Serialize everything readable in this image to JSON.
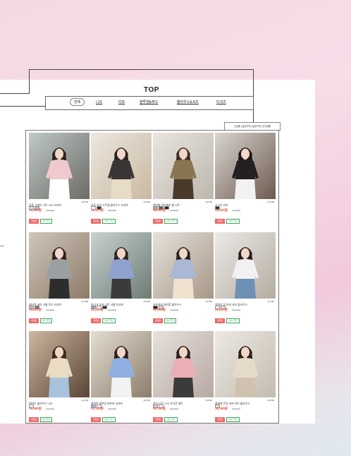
{
  "page": {
    "title": "TOP"
  },
  "categories": [
    {
      "label": "전체",
      "active": true
    },
    {
      "label": "니트",
      "active": false
    },
    {
      "label": "티트",
      "active": false
    },
    {
      "label": "맨투맨&후드",
      "active": false
    },
    {
      "label": "블라우스&셔츠",
      "active": false
    },
    {
      "label": "티셔츠",
      "active": false
    }
  ],
  "sort": {
    "label": "신상품 | 낮은가격 | 높은가격 | 인기상품"
  },
  "colors": {
    "price": "#e04a3a",
    "sale_badge": "#ef6a6a",
    "event_badge": "#3aa55a",
    "grid_border": "#777777"
  },
  "products": [
    {
      "name": "심플 그레이 나트 나시 티셔츠",
      "price": "19,660원",
      "old": "21,600원",
      "badge1": "세일중",
      "badge2": "9% 할인",
      "opts": "[44-66]",
      "swatches": [
        "#cfe3f7",
        "#a7c6e6"
      ],
      "bg": [
        "#bfc9c5",
        "#6c6a66"
      ],
      "hair": "#2a2220",
      "top": "#f0c9cf",
      "bottom": "#ffffff"
    },
    {
      "name": "오픈 사선 스트랩 블라우스 티셔츠",
      "price": "14,220원",
      "old": "15,800원",
      "badge1": "세일중",
      "badge2": "10% 할인",
      "opts": "[44-66]",
      "swatches": [
        "#ffffff",
        "#333333"
      ],
      "bg": [
        "#ece7de",
        "#c9b8a2"
      ],
      "hair": "#2b2220",
      "top": "#3a3535",
      "bottom": "#e7dcc6"
    },
    {
      "name": "케이블 라인베어 쓸 니트",
      "price": "36,955원",
      "old": "41,060원",
      "badge1": "세일중",
      "badge2": "10% 할인",
      "opts": "[44-66]",
      "swatches": [
        "#b7a58a",
        "#6d5a44",
        "#222222"
      ],
      "bg": [
        "#e9e5df",
        "#bdb7ad"
      ],
      "hair": "#3a2d25",
      "top": "#8a7552",
      "bottom": "#4a3a2a"
    },
    {
      "name": "시스루 셔츠",
      "price": "16,020원",
      "old": "17,800원",
      "badge1": "세일중",
      "badge2": "10% 할인",
      "opts": "[44-66]",
      "swatches": [
        "#333333"
      ],
      "bg": [
        "#d9d4cf",
        "#6d5a4f"
      ],
      "hair": "#201818",
      "top": "#231f22",
      "bottom": "#f2f2f2"
    },
    {
      "name": "레터링 세라 크롭 후드 티셔츠",
      "price": "29,620원",
      "old": "32,800원",
      "badge1": "세일중",
      "badge2": "9% 할인",
      "opts": "[44-66]",
      "swatches": [
        "#bfbfbf",
        "#777777"
      ],
      "bg": [
        "#cfc6bb",
        "#8e7b68"
      ],
      "hair": "#2d2420",
      "top": "#9aa0a2",
      "bottom": "#2d2d2d"
    },
    {
      "name": "유니크 오프 나트 크롭 티셔츠",
      "price": "11,210원",
      "old": "12,900원",
      "badge1": "세일중",
      "badge2": "10% 할인",
      "opts": "[44-66]",
      "swatches": [
        "#8fa6d4",
        "#ffffff",
        "#333333"
      ],
      "bg": [
        "#c8d2cf",
        "#6e7b74"
      ],
      "hair": "#2b2520",
      "top": "#8fa2d0",
      "bottom": "#3b3b3b"
    },
    {
      "name": "오픈카라 체리용 블라우스",
      "price": "36,955원",
      "old": "41,060원",
      "badge1": "세일중",
      "badge2": "9% 할인",
      "opts": "[44-66]",
      "swatches": [
        "#222222",
        "#cfd8e6"
      ],
      "bg": [
        "#e6e2dc",
        "#a79787"
      ],
      "hair": "#2a211c",
      "top": "#aab8d6",
      "bottom": "#efe3cf"
    },
    {
      "name": "데일리 원 카라 셔츠 블라우스",
      "price": "26,620원",
      "old": "29,800원",
      "badge1": "세일중",
      "badge2": "10% 할인",
      "opts": "[44-66]",
      "swatches": [
        "#ffffff",
        "#dfe6f2"
      ],
      "bg": [
        "#ebe9e6",
        "#b4aca1"
      ],
      "hair": "#2a201a",
      "top": "#f3f1f4",
      "bottom": "#6f90b5"
    },
    {
      "name": "에이드 블라우스 나시",
      "price": "19,660원",
      "old": "21,600원",
      "badge1": "세일중",
      "badge2": "9% 할인",
      "opts": "[44-66]",
      "swatches": [
        "#ffffff"
      ],
      "bg": [
        "#cdb7a0",
        "#5a4436"
      ],
      "hair": "#3a2a20",
      "top": "#eadbc4",
      "bottom": "#a9c2dc"
    },
    {
      "name": "레이턴 셀프업 퍼프와 티셔츠",
      "price": "31,140원",
      "old": "34,600원",
      "badge1": "세일중",
      "badge2": "10% 할인",
      "opts": "[44-66]",
      "swatches": [
        "#9bbbe8",
        "#ffffff"
      ],
      "bg": [
        "#e4ddd2",
        "#8c7d6a"
      ],
      "hair": "#2a201c",
      "top": "#8fb0e0",
      "bottom": "#f2f2f2"
    },
    {
      "name": "로터 니트 나시 가디건 세트",
      "price": "35,340원",
      "old": "39,270원",
      "badge1": "세일중",
      "badge2": "10% 할인",
      "opts": "[44-66]",
      "swatches": [
        "#f1c1c8",
        "#ffffff"
      ],
      "bg": [
        "#e7e0dc",
        "#b7a9a1"
      ],
      "hair": "#2a201c",
      "top": "#e9aeb6",
      "bottom": "#3d3a3c"
    },
    {
      "name": "플레워 트일 리본 타이 블라우스",
      "price": "16,290원",
      "old": "18,100원",
      "badge1": "세일중",
      "badge2": "10% 할인",
      "opts": "[44-66]",
      "swatches": [
        "#f0e2b9"
      ],
      "bg": [
        "#ece8e2",
        "#c4bcb1"
      ],
      "hair": "#2a201b",
      "top": "#e6dbc8",
      "bottom": "#cfc3b0"
    }
  ]
}
